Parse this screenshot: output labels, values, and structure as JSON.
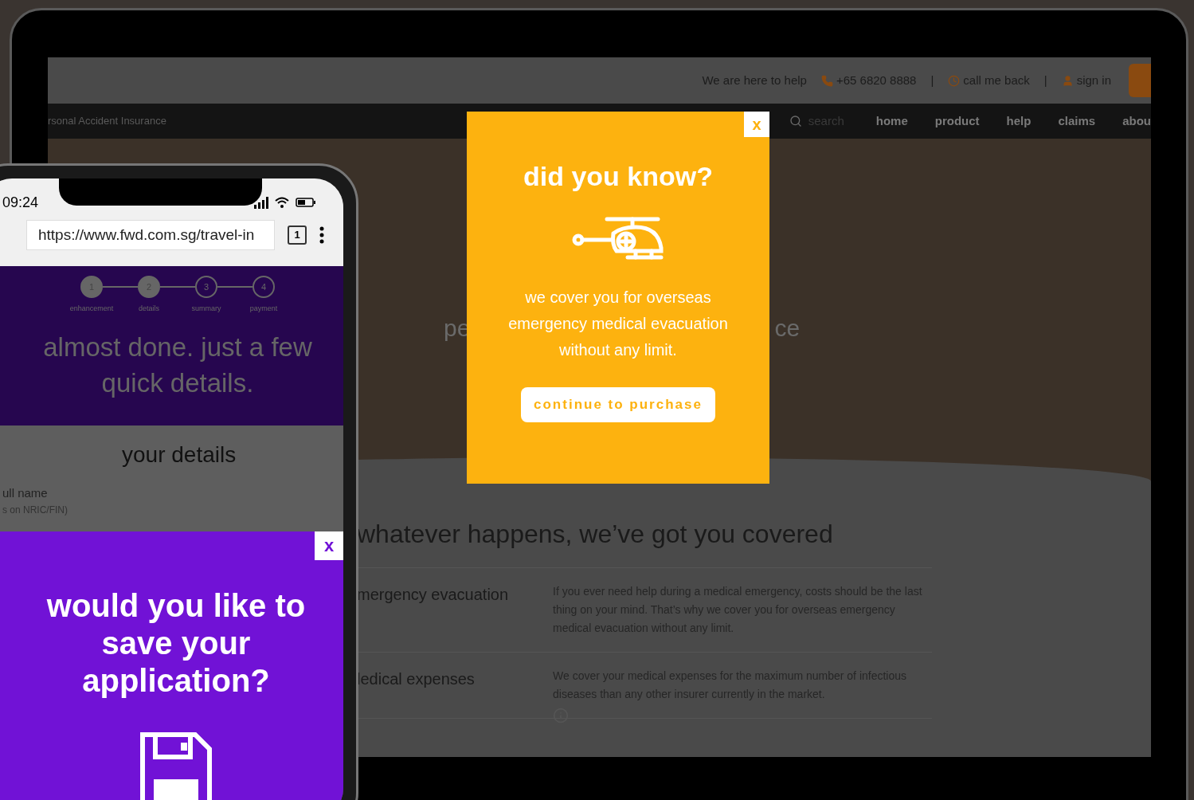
{
  "laptop": {
    "top_bar": {
      "tagline": "We are here to help",
      "phone": "+65 6820 8888",
      "separator_1": "|",
      "callback": "call me back",
      "separator_2": "|",
      "sign_in": "sign in"
    },
    "nav": {
      "breadcrumb": "rsonal Accident Insurance",
      "search_placeholder": "search",
      "items": [
        {
          "label": "home"
        },
        {
          "label": "product"
        },
        {
          "label": "help"
        },
        {
          "label": "claims"
        },
        {
          "label": "abou"
        }
      ]
    },
    "hero": {
      "text_left": "pe",
      "text_right": "ce"
    },
    "section": {
      "title": "whatever happens, we’ve got you covered",
      "rows": [
        {
          "name": "mergency evacuation",
          "description": "If you ever need help during a medical emergency, costs should be the last thing on your mind. That’s why we cover you for overseas emergency medical evacuation without any limit."
        },
        {
          "name": "ledical expenses",
          "description": "We cover your medical expenses for the maximum number of infectious diseases than any other insurer currently in the market."
        }
      ]
    },
    "popup": {
      "close": "x",
      "title": "did you know?",
      "body": "we cover you for overseas emergency medical evacuation without any limit.",
      "button": "continue to purchase"
    }
  },
  "phone": {
    "time": "09:24",
    "url": "https://www.fwd.com.sg/travel-in",
    "tab_count": "1",
    "steps": [
      {
        "number": "1",
        "label": "enhancement",
        "done": true
      },
      {
        "number": "2",
        "label": "details",
        "done": true
      },
      {
        "number": "3",
        "label": "summary",
        "done": false
      },
      {
        "number": "4",
        "label": "payment",
        "done": false
      }
    ],
    "headline": "almost done. just a few quick details.",
    "section_title": "your details",
    "field_label": "ull name",
    "field_hint": "s on NRIC/FIN)",
    "popup": {
      "close": "x",
      "title": "would you like to save your application?"
    }
  }
}
